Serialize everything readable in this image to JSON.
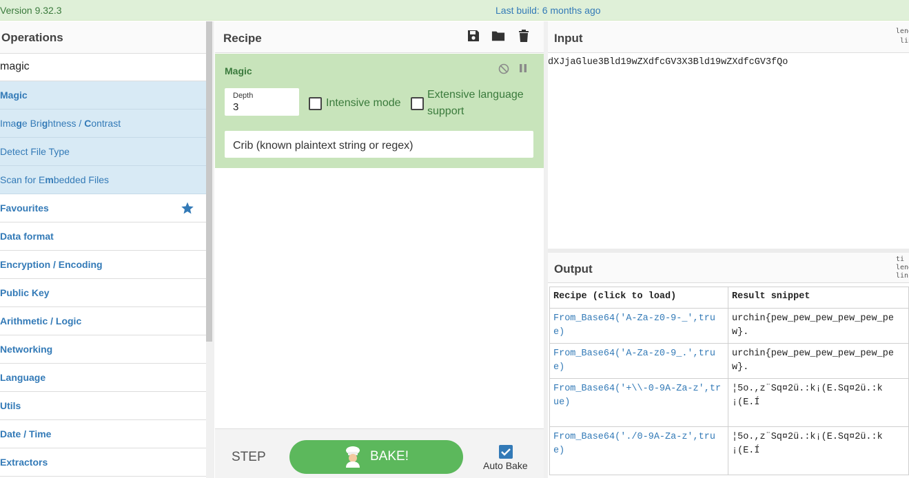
{
  "banner": {
    "version": "Version 9.32.3",
    "last_build": "Last build: 6 months ago"
  },
  "operations": {
    "title": "Operations",
    "search_value": "magic",
    "search_results": [
      {
        "label": "Magic",
        "bold": true
      },
      {
        "label": "Image Brightness / Contrast",
        "bold": false
      },
      {
        "label": "Detect File Type",
        "bold": false
      },
      {
        "label": "Scan for Embedded Files",
        "bold": false
      }
    ],
    "categories": [
      "Favourites",
      "Data format",
      "Encryption / Encoding",
      "Public Key",
      "Arithmetic / Logic",
      "Networking",
      "Language",
      "Utils",
      "Date / Time",
      "Extractors"
    ],
    "favourites_icon": "star-icon"
  },
  "recipe": {
    "title": "Recipe",
    "icons": [
      "save-icon",
      "folder-icon",
      "trash-icon"
    ],
    "operation": {
      "name": "Magic",
      "depth_label": "Depth",
      "depth_value": "3",
      "intensive_label": "Intensive mode",
      "intensive_checked": false,
      "extensive_label_line1": "Extensive language",
      "extensive_label_line2": "support",
      "extensive_checked": false,
      "crib_placeholder": "Crib (known plaintext string or regex)"
    },
    "step_label": "STEP",
    "bake_label": "BAKE!",
    "auto_bake_label": "Auto Bake",
    "auto_bake_checked": true
  },
  "input": {
    "title": "Input",
    "stats": [
      "leng",
      "lin"
    ],
    "text": "dXJjaGlue3Bld19wZXdfcGV3X3Bld19wZXdfcGV3fQo"
  },
  "output": {
    "title": "Output",
    "stats": [
      "ti",
      "leng",
      "lin"
    ],
    "columns": [
      "Recipe (click to load)",
      "Result snippet"
    ],
    "rows": [
      {
        "recipe": "From_Base64('A-Za-z0-9-_',true)",
        "snippet": "urchin{pew_pew_pew_pew_pew_pew}."
      },
      {
        "recipe": "From_Base64('A-Za-z0-9_.',true)",
        "snippet": "urchin{pew_pew_pew_pew_pew_pew}."
      },
      {
        "recipe": "From_Base64('+\\\\-0-9A-Za-z',true)",
        "snippet": "¦5o.,z¨Sq¤2ü.:k¡(E.Sq¤2ü.:k¡(E.Í"
      },
      {
        "recipe": "From_Base64('./0-9A-Za-z',true)",
        "snippet": "¦5o.,z¨Sq¤2ü.:k¡(E.Sq¤2ü.:k¡(E.Í"
      }
    ]
  },
  "colors": {
    "accent": "#337ab7",
    "bake": "#5cb85c",
    "recipe_card": "#c8e4bb",
    "highlight": "#d8eaf5"
  }
}
